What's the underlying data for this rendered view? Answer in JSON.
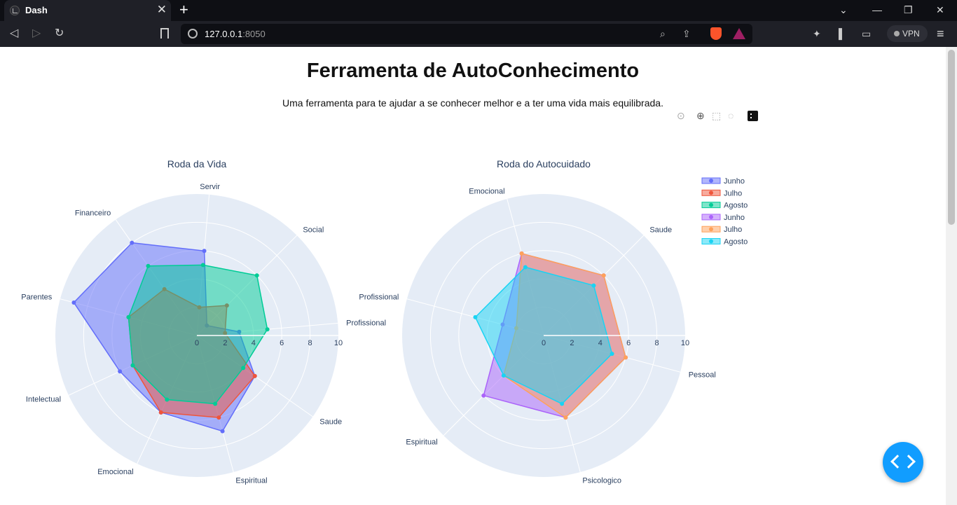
{
  "browser": {
    "tab_title": "Dash",
    "url_host": "127.0.0.1",
    "url_port": ":8050",
    "vpn_label": "VPN"
  },
  "page": {
    "title": "Ferramenta de AutoConhecimento",
    "subtitle": "Uma ferramenta para te ajudar a se conhecer melhor e a ter uma vida mais equilibrada."
  },
  "modebar": {
    "icons": [
      "camera-icon",
      "zoom-icon",
      "select-icon",
      "lasso-icon",
      "plotly-logo"
    ]
  },
  "colors": {
    "polar_bg": "#e5ecf6",
    "grid": "#ffffff",
    "text": "#2a3f5f"
  },
  "chart_data": [
    {
      "type": "radar",
      "title": "Roda da Vida",
      "categories": [
        "Profissional",
        "Social",
        "Servir",
        "Financeiro",
        "Parentes",
        "Intelectual",
        "Emocional",
        "Espiritual",
        "Saude"
      ],
      "radial_range": [
        0,
        10
      ],
      "radial_ticks": [
        "0",
        "2",
        "4",
        "6",
        "8",
        "10"
      ],
      "series": [
        {
          "name": "Junho",
          "color": "#636efa",
          "values": [
            3,
            1,
            6,
            8,
            9,
            6,
            6,
            7,
            5
          ]
        },
        {
          "name": "Julho",
          "color": "#ef553b",
          "values": [
            2,
            3,
            2,
            4,
            5,
            5,
            6,
            6,
            5
          ]
        },
        {
          "name": "Agosto",
          "color": "#00cc96",
          "values": [
            5,
            6,
            5,
            6,
            5,
            5,
            5,
            5,
            4
          ]
        }
      ]
    },
    {
      "type": "radar",
      "title": "Roda do Autocuidado",
      "categories": [
        "Pessoal",
        "Saude",
        "Emocional",
        "Profissional",
        "Espiritual",
        "Psicologico"
      ],
      "radial_range": [
        0,
        10
      ],
      "radial_ticks": [
        "0",
        "2",
        "4",
        "6",
        "8",
        "10"
      ],
      "series": [
        {
          "name": "Junho",
          "color": "#ab63fa",
          "values": [
            6,
            6,
            6,
            3,
            6,
            6
          ]
        },
        {
          "name": "Julho",
          "color": "#ffa15a",
          "values": [
            6,
            6,
            6,
            2,
            4,
            6
          ]
        },
        {
          "name": "Agosto",
          "color": "#19d3f3",
          "values": [
            5,
            5,
            5,
            5,
            4,
            5
          ]
        }
      ]
    }
  ],
  "legend": {
    "entries": [
      {
        "name": "Junho",
        "color": "#636efa"
      },
      {
        "name": "Julho",
        "color": "#ef553b"
      },
      {
        "name": "Agosto",
        "color": "#00cc96"
      },
      {
        "name": "Junho",
        "color": "#ab63fa"
      },
      {
        "name": "Julho",
        "color": "#ffa15a"
      },
      {
        "name": "Agosto",
        "color": "#19d3f3"
      }
    ]
  }
}
